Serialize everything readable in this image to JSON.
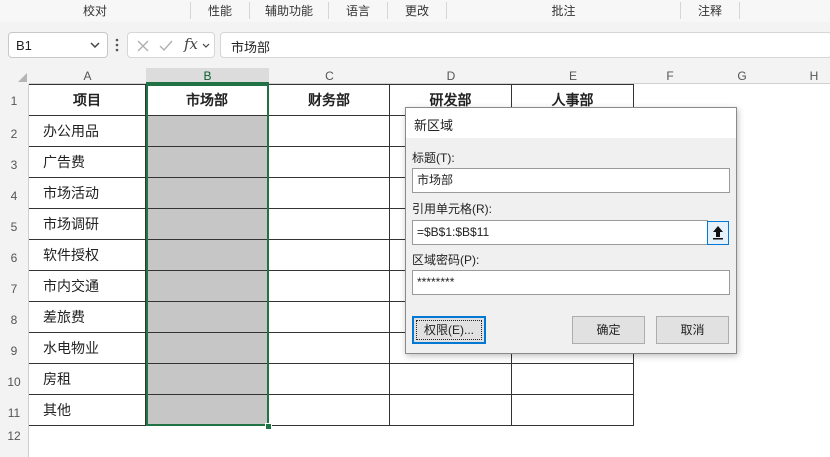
{
  "ribbon": {
    "groups": [
      "校对",
      "性能",
      "辅助功能",
      "语言",
      "更改",
      "批注",
      "注释"
    ]
  },
  "formula_bar": {
    "name_box": "B1",
    "fx_label": "fx",
    "content": "市场部"
  },
  "sheet": {
    "columns": [
      "A",
      "B",
      "C",
      "D",
      "E",
      "F",
      "G",
      "H"
    ],
    "rows": [
      "1",
      "2",
      "3",
      "4",
      "5",
      "6",
      "7",
      "8",
      "9",
      "10",
      "11",
      "12"
    ],
    "header_row": [
      "项目",
      "市场部",
      "财务部",
      "研发部",
      "人事部"
    ],
    "items": [
      "办公用品",
      "广告费",
      "市场活动",
      "市场调研",
      "软件授权",
      "市内交通",
      "差旅费",
      "水电物业",
      "房租",
      "其他"
    ],
    "selected_range": "B1:B11",
    "accent_color": "#217346",
    "selection_fill": "#c6c6c6"
  },
  "dialog": {
    "title": "新区域",
    "title_label": "标题(T):",
    "title_value": "市场部",
    "ref_label": "引用单元格(R):",
    "ref_value": "=$B$1:$B$11",
    "password_label": "区域密码(P):",
    "password_value": "********",
    "permissions_button": "权限(E)...",
    "ok_button": "确定",
    "cancel_button": "取消",
    "focus_color": "#0078d4"
  }
}
